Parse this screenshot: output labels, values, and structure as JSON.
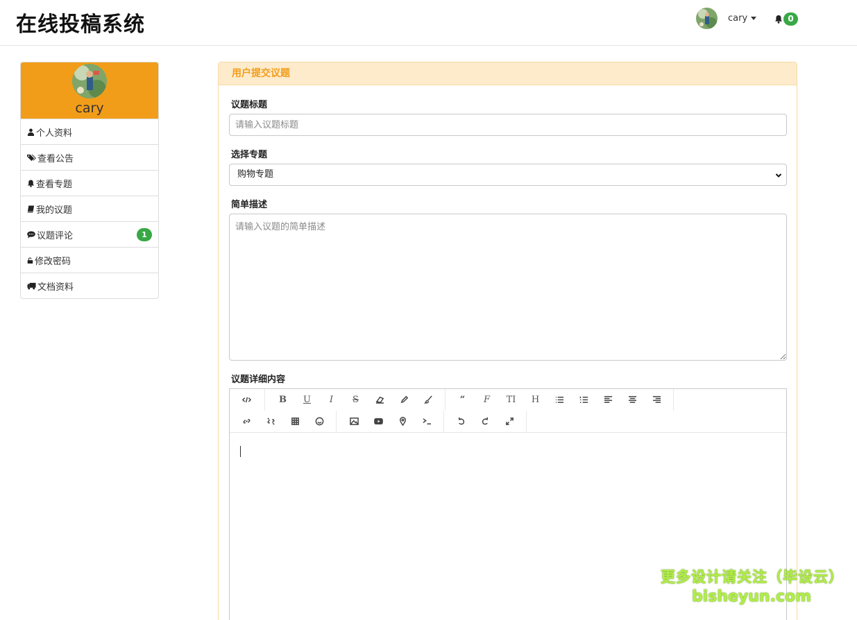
{
  "header": {
    "brand": "在线投稿系统",
    "user": {
      "name": "cary"
    },
    "notifications": {
      "count": "0"
    }
  },
  "sidebar": {
    "profile_name": "cary",
    "items": [
      {
        "label": "个人资料",
        "icon": "user-icon"
      },
      {
        "label": "查看公告",
        "icon": "tags-icon"
      },
      {
        "label": "查看专题",
        "icon": "bell-icon"
      },
      {
        "label": "我的议题",
        "icon": "book-icon"
      },
      {
        "label": "议题评论",
        "icon": "comment-icon",
        "badge": "1"
      },
      {
        "label": "修改密码",
        "icon": "unlock-icon"
      },
      {
        "label": "文档资料",
        "icon": "truck-icon"
      }
    ]
  },
  "form": {
    "panel_title": "用户提交议题",
    "title_label": "议题标题",
    "title_placeholder": "请输入议题标题",
    "topic_label": "选择专题",
    "topic_value": "购物专题",
    "desc_label": "简单描述",
    "desc_placeholder": "请输入议题的简单描述",
    "content_label": "议题详细内容"
  },
  "editor": {
    "toolbar_row1": [
      [
        "code-view-icon"
      ],
      [
        "bold-icon",
        "underline-icon",
        "italic-icon",
        "strikethrough-icon",
        "eraser-icon",
        "pencil-icon",
        "brush-icon"
      ],
      [
        "quote-icon",
        "font-icon",
        "font-size-icon",
        "heading-icon",
        "bullet-list-icon",
        "numbered-list-icon",
        "align-left-icon",
        "align-center-icon",
        "align-right-icon"
      ]
    ],
    "toolbar_row2": [
      [
        "link-icon",
        "unlink-icon",
        "table-icon",
        "emoji-icon"
      ],
      [
        "image-icon",
        "video-icon",
        "map-pin-icon",
        "terminal-icon"
      ],
      [
        "undo-icon",
        "redo-icon",
        "fullscreen-icon"
      ]
    ]
  },
  "watermark": {
    "line1": "更多设计请关注（毕设云）",
    "line2": "bisheyun.com"
  }
}
